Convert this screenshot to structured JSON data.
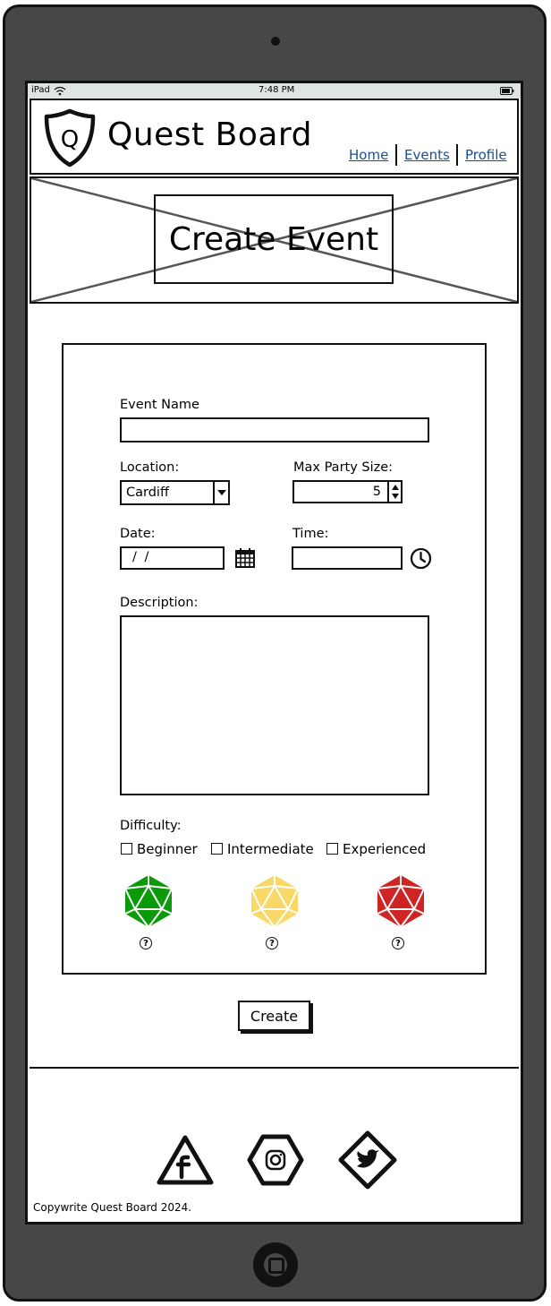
{
  "device": {
    "model_label": "iPad",
    "time": "7:48 PM"
  },
  "header": {
    "logo_letter": "Q",
    "brand": "Quest Board",
    "nav": [
      "Home",
      "Events",
      "Profile"
    ]
  },
  "banner": {
    "title": "Create Event"
  },
  "form": {
    "event_name_label": "Event Name",
    "event_name_value": "",
    "location_label": "Location:",
    "location_value": "Cardiff",
    "party_size_label": "Max Party Size:",
    "party_size_value": "5",
    "date_label": "Date:",
    "date_value": "/ /",
    "time_label": "Time:",
    "time_value": "",
    "description_label": "Description:",
    "description_value": "",
    "difficulty_label": "Difficulty:",
    "difficulty_options": [
      "Beginner",
      "Intermediate",
      "Experienced"
    ],
    "difficulty_colors": [
      "#0a9a0a",
      "#f8d866",
      "#d02323"
    ],
    "help_glyph": "?",
    "submit_label": "Create"
  },
  "footer": {
    "social_icons": [
      "facebook-icon",
      "instagram-icon",
      "twitter-icon"
    ],
    "copyright": "Copywrite Quest Board 2024."
  },
  "colors": {
    "device_body": "#474747",
    "link": "#1a4f94",
    "statusbar": "#dfe4e4"
  }
}
